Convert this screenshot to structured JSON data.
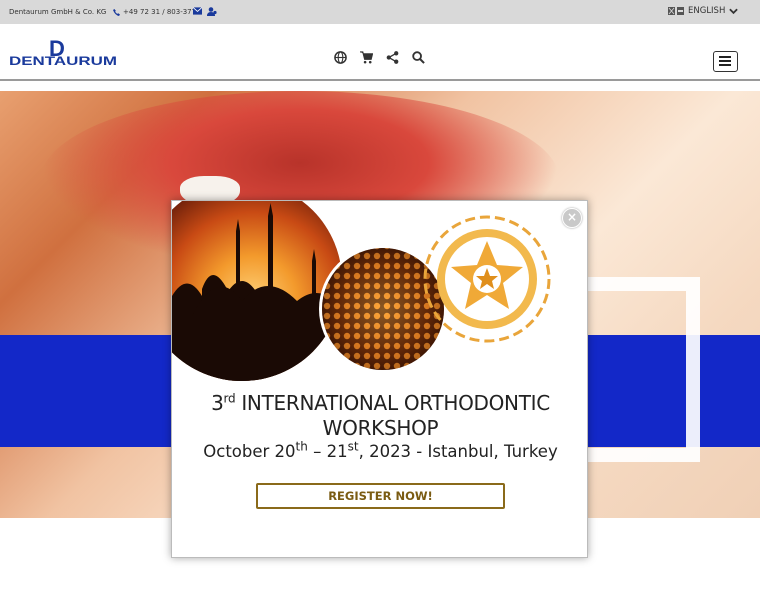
{
  "topbar": {
    "company": "Dentaurum GmbH & Co. KG",
    "phone": "+49 72 31 / 803-377",
    "language": "ENGLISH",
    "icons": [
      "phone-icon",
      "mail-icon",
      "user-icon",
      "flags-icon",
      "chevron-down-icon"
    ]
  },
  "header": {
    "logo_text": "DENTAURUM",
    "logo_letter": "D",
    "nav_icons": [
      "globe-icon",
      "cart-icon",
      "share-icon",
      "search-icon"
    ],
    "menu_icon": "hamburger-menu-icon"
  },
  "colors": {
    "topbar_bg": "#d9d9d9",
    "brand_blue": "#1a3a9c",
    "band_blue": "#1328c8",
    "register_gold": "#8a6a1a"
  },
  "popup": {
    "close_label": "×",
    "title_number": "3",
    "title_suffix": "rd",
    "title_rest": " INTERNATIONAL ORTHODONTIC",
    "title_line2": "WORKSHOP",
    "date_part1": "October 20",
    "date_sup1": "th",
    "date_part2": " – 21",
    "date_sup2": "st",
    "date_part3": ", 2023 - Istanbul, Turkey",
    "register_label": "REGISTER NOW!"
  }
}
